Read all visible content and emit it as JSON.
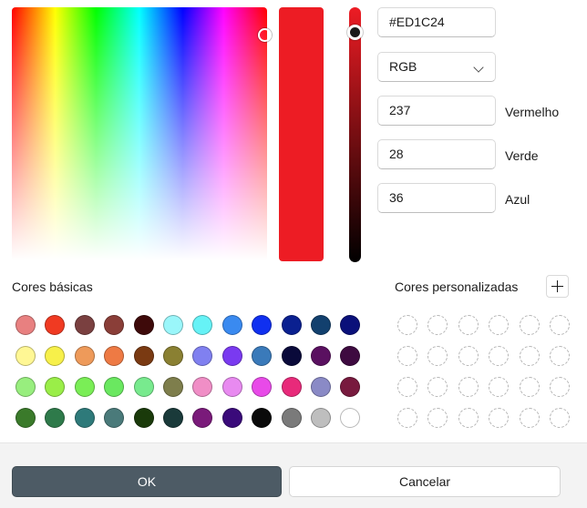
{
  "picker": {
    "hex": "#ED1C24",
    "model": "RGB",
    "red_value": "237",
    "green_value": "28",
    "blue_value": "36",
    "red_label": "Vermelho",
    "green_label": "Verde",
    "blue_label": "Azul",
    "selected_color": "#ED1C24"
  },
  "sections": {
    "basic_title": "Cores básicas",
    "custom_title": "Cores personalizadas"
  },
  "basic_colors": [
    [
      "#E88080",
      "#F03A22",
      "#7A4040",
      "#8A3E38",
      "#3E0A0A",
      "#9AF6FA",
      "#66F2F6",
      "#3A8AF0",
      "#1030F0",
      "#0A2090",
      "#12406E",
      "#0A107A"
    ],
    [
      "#FFF794",
      "#F7F04A",
      "#EE9A5A",
      "#EE7A44",
      "#7A3A12",
      "#8A8032",
      "#8080F0",
      "#7A3AF0",
      "#3A7ABA",
      "#0A0A3A",
      "#5A1060",
      "#3E0A40"
    ],
    [
      "#98EE7E",
      "#9AEE48",
      "#7AEE56",
      "#6AE860",
      "#78EA8E",
      "#7E7E4C",
      "#F08EC6",
      "#E88AF0",
      "#E84AE8",
      "#E82A7A",
      "#8A8AC6",
      "#781A3E"
    ],
    [
      "#3A7A2A",
      "#2E7A4A",
      "#2E7A7A",
      "#4A7A7A",
      "#1A3A0A",
      "#1A3A3A",
      "#7A1A7A",
      "#3A0A7A",
      "#0A0A0A",
      "#7A7A7A",
      "#BEBEBE",
      "#FFFFFF"
    ]
  ],
  "custom_slots": {
    "rows": 4,
    "cols": 6
  },
  "buttons": {
    "ok": "OK",
    "cancel": "Cancelar"
  },
  "icons": {
    "add": "plus-icon",
    "dropdown": "chevron-down-icon"
  }
}
